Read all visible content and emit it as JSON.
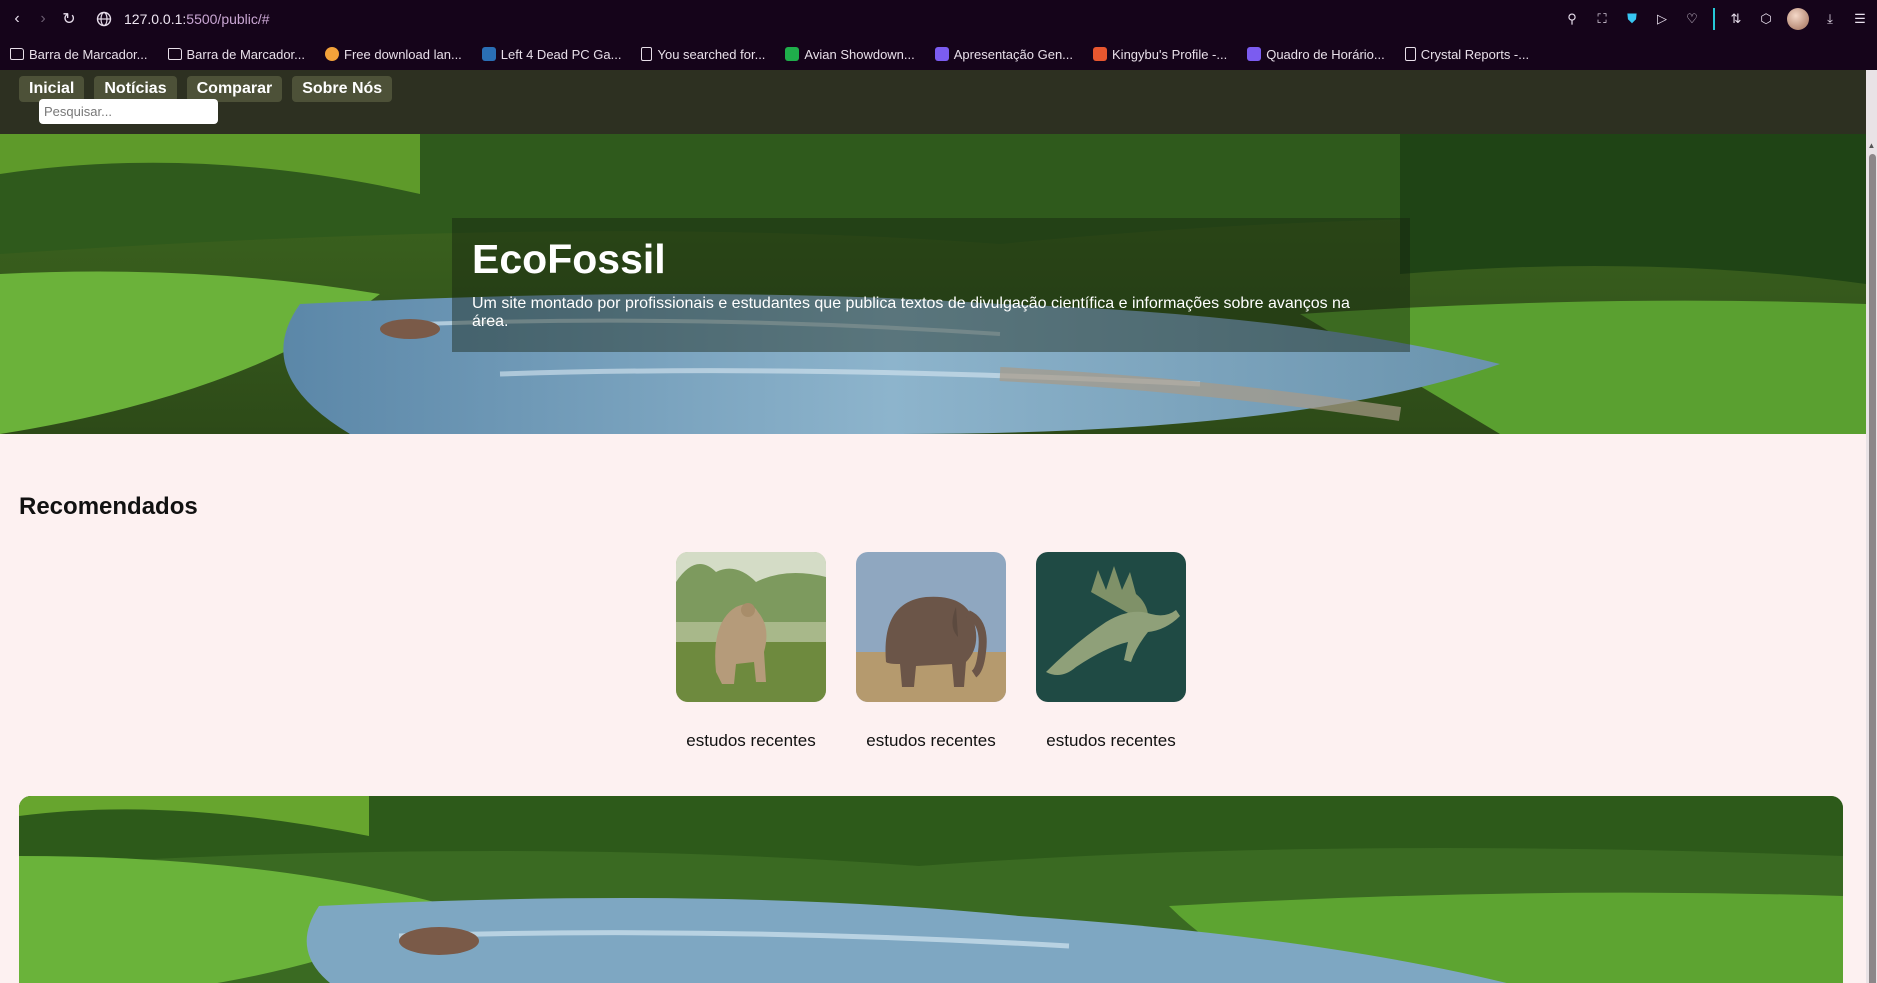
{
  "browser": {
    "url_host": "127.0.0.1:",
    "url_rest": "5500/public/#",
    "bookmarks": [
      {
        "label": "Barra de Marcador...",
        "icon": "folder-icon"
      },
      {
        "label": "Barra de Marcador...",
        "icon": "folder-icon"
      },
      {
        "label": "Free download lan...",
        "icon": "fox-icon"
      },
      {
        "label": "Left 4 Dead PC Ga...",
        "icon": "f-site-icon"
      },
      {
        "label": "You searched for...",
        "icon": "page-icon"
      },
      {
        "label": "Avian Showdown...",
        "icon": "bl-site-icon"
      },
      {
        "label": "Apresentação Gen...",
        "icon": "shield-site-icon"
      },
      {
        "label": "Kingybu's Profile -...",
        "icon": "kingybu-icon"
      },
      {
        "label": "Quadro de Horário...",
        "icon": "shield-site-icon"
      },
      {
        "label": "Crystal Reports -...",
        "icon": "page-icon"
      }
    ],
    "accent": "#26c9d8",
    "chrome_bg": "#15041a"
  },
  "header": {
    "menu": [
      "Inicial",
      "Notícias",
      "Comparar",
      "Sobre Nós"
    ],
    "search_placeholder": "Pesquisar...",
    "bg": "#2d3021"
  },
  "hero": {
    "title": "EcoFossil",
    "subtitle": "Um site montado por profissionais e estudantes que publica textos de divulgação científica e informações sobre avanços na área."
  },
  "recommended": {
    "title": "Recomendados",
    "cards": [
      {
        "label": "estudos recentes",
        "image": "ground-sloth-image"
      },
      {
        "label": "estudos recentes",
        "image": "elephant-image"
      },
      {
        "label": "estudos recentes",
        "image": "spinosaurus-image"
      }
    ]
  },
  "page_bg": "#fdf1f1"
}
